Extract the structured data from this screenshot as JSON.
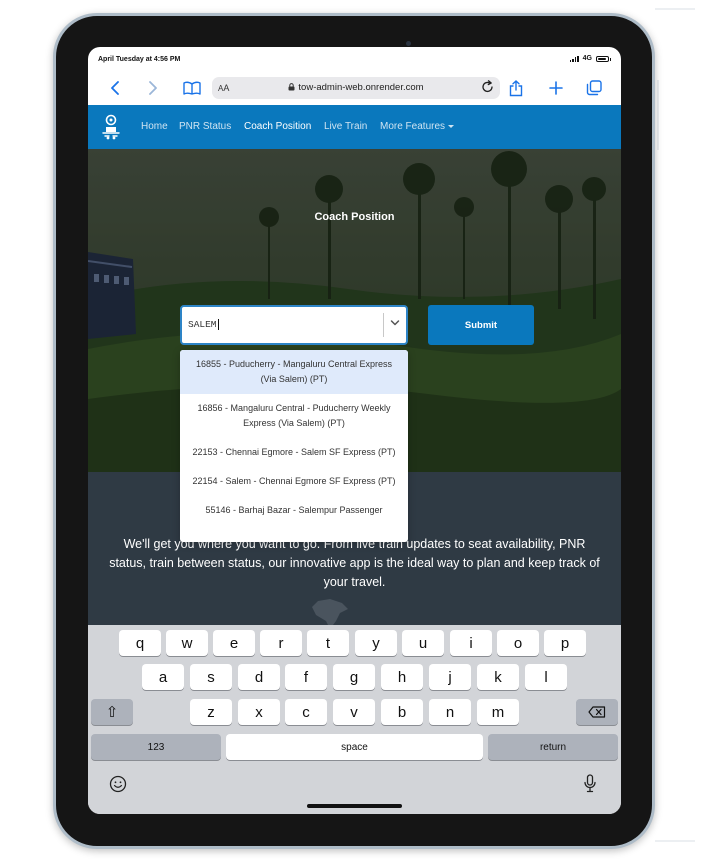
{
  "status_bar": {
    "time": "April Tuesday at 4:56 PM",
    "network": "4G",
    "battery_level": 0.9
  },
  "browser": {
    "text_size_label_small": "A",
    "text_size_label_large": "A",
    "url": "tow-admin-web.onrender.com",
    "icons": [
      "chevron-left-icon",
      "chevron-right-icon",
      "book-icon",
      "lock-icon",
      "reload-icon",
      "share-icon",
      "plus-icon",
      "tabs-icon"
    ]
  },
  "navbar": {
    "items": [
      {
        "label": "Home",
        "active": false
      },
      {
        "label": "PNR Status",
        "active": false
      },
      {
        "label": "Coach Position",
        "active": true
      },
      {
        "label": "Live Train",
        "active": false
      },
      {
        "label": "More Features",
        "active": false
      }
    ],
    "colors": {
      "bar": "#0a78bd",
      "active_text": "#ffffff",
      "text": "#cfe4f2"
    }
  },
  "hero": {
    "title": "Coach Position",
    "search": {
      "value": "SALEM"
    },
    "submit_label": "Submit"
  },
  "dropdown": {
    "options": [
      "16855 - Puducherry - Mangaluru Central Express (Via Salem) (PT)",
      "16856 - Mangaluru Central - Puducherry Weekly Express (Via Salem) (PT)",
      "22153 - Chennai Egmore - Salem SF Express (PT)",
      "22154 - Salem - Chennai Egmore SF Express (PT)",
      "55146 - Barhaj Bazar - Salempur Passenger"
    ],
    "highlighted_index": 0
  },
  "about": {
    "text": "We'll get you where you want to go. From live train updates to seat availability, PNR status, train between status, our innovative app is the ideal way to plan and keep track of your travel."
  },
  "keyboard": {
    "row1": [
      "q",
      "w",
      "e",
      "r",
      "t",
      "y",
      "u",
      "i",
      "o",
      "p"
    ],
    "row2": [
      "a",
      "s",
      "d",
      "f",
      "g",
      "h",
      "j",
      "k",
      "l"
    ],
    "row3": [
      "z",
      "x",
      "c",
      "v",
      "b",
      "n",
      "m"
    ],
    "shift_label": "⇧",
    "numbers_label": "123",
    "space_label": "space",
    "return_label": "return",
    "icons": [
      "shift-icon",
      "backspace-icon",
      "emoji-icon",
      "microphone-icon"
    ]
  }
}
